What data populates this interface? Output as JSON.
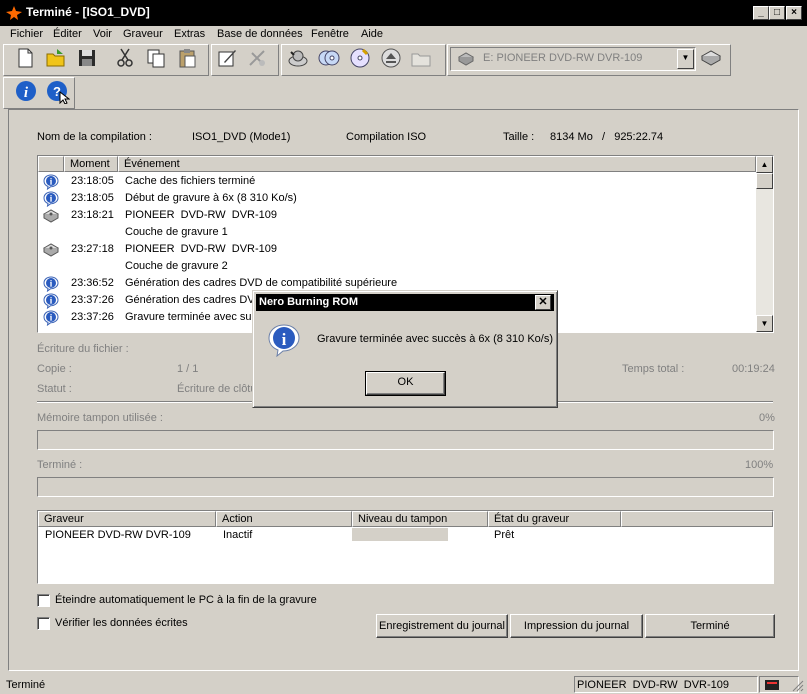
{
  "window": {
    "title": "Terminé - [ISO1_DVD]"
  },
  "menu": [
    "Fichier",
    "Éditer",
    "Voir",
    "Graveur",
    "Extras",
    "Base de données",
    "Fenêtre",
    "Aide"
  ],
  "toolbar": {
    "drive_select": "E: PIONEER  DVD-RW  DVR-109"
  },
  "info": {
    "compilation_label": "Nom de la compilation :",
    "compilation_value": "ISO1_DVD (Mode1)",
    "type": "Compilation ISO",
    "size_label": "Taille :",
    "size_value": "8134 Mo   /   925:22.74"
  },
  "log": {
    "col_moment": "Moment",
    "col_event": "Événement",
    "rows": [
      {
        "icon": "info",
        "time": "23:18:05",
        "event": "Cache des fichiers terminé"
      },
      {
        "icon": "info",
        "time": "23:18:05",
        "event": "Début de gravure à 6x (8 310 Ko/s)"
      },
      {
        "icon": "drive",
        "time": "23:18:21",
        "event": "PIONEER  DVD-RW  DVR-109"
      },
      {
        "icon": "",
        "time": "",
        "event": "Couche de gravure 1"
      },
      {
        "icon": "drive",
        "time": "23:27:18",
        "event": "PIONEER  DVD-RW  DVR-109"
      },
      {
        "icon": "",
        "time": "",
        "event": "Couche de gravure 2"
      },
      {
        "icon": "info",
        "time": "23:36:52",
        "event": "Génération des cadres DVD de compatibilité supérieure"
      },
      {
        "icon": "info",
        "time": "23:37:26",
        "event": "Génération des cadres DVI"
      },
      {
        "icon": "info",
        "time": "23:37:26",
        "event": "Gravure terminée avec suc"
      }
    ]
  },
  "progress": {
    "file_label": "Écriture du fichier :",
    "copy_label": "Copie :",
    "copy_value": "1 / 1",
    "status_label": "Statut :",
    "status_value": "Écriture de clôtu",
    "total_time_label": "Temps total :",
    "total_time_value": "00:19:24",
    "buffer_label": "Mémoire tampon utilisée :",
    "buffer_percent": "0%",
    "buffer_fraction": 0,
    "done_label": "Terminé :",
    "done_percent": "100%",
    "done_fraction": 1
  },
  "recorders": {
    "col_recorder": "Graveur",
    "col_action": "Action",
    "col_buffer": "Niveau du tampon",
    "col_state": "État du graveur",
    "rows": [
      {
        "recorder": "PIONEER DVD-RW  DVR-109",
        "action": "Inactif",
        "state": "Prêt"
      }
    ]
  },
  "options": {
    "shutdown": "Éteindre automatiquement le PC à la fin de la gravure",
    "verify": "Vérifier les données écrites"
  },
  "buttons": {
    "save_log": "Enregistrement du journal",
    "print_log": "Impression du journal",
    "done": "Terminé"
  },
  "dialog": {
    "title": "Nero Burning ROM",
    "message": "Gravure terminée avec succès à 6x (8 310 Ko/s)",
    "ok": "OK"
  },
  "statusbar": {
    "left": "Terminé",
    "drive": "PIONEER  DVD-RW  DVR-109"
  }
}
